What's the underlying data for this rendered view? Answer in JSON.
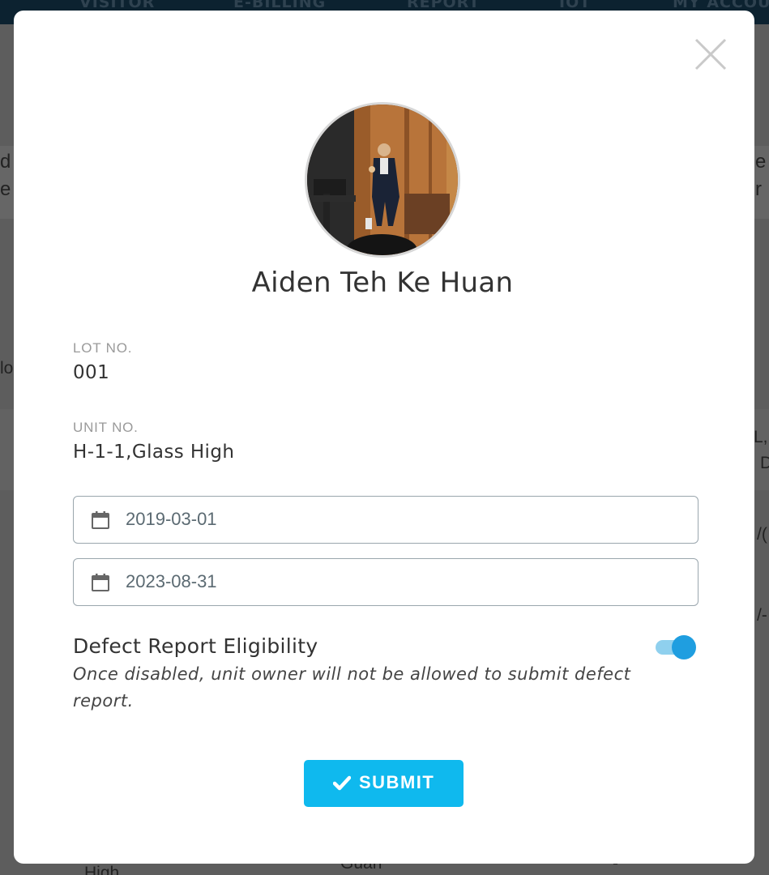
{
  "background": {
    "nav_items": [
      "VISITOR",
      "E-BILLING",
      "REPORT",
      "IOT",
      "MY ACCOU"
    ],
    "fragments": {
      "left_top": "d",
      "left_mid": "e",
      "left_input": "lo",
      "right_top": "e",
      "right_mid": "r",
      "right_p": "L,P",
      "right_d": "D",
      "right_slash1": "/(",
      "right_slash2": "/-",
      "bottom_left": "High",
      "bottom_mid": "Guan",
      "bottom_dash": "-"
    }
  },
  "modal": {
    "close_icon": "close-icon",
    "user": {
      "name": "Aiden Teh Ke Huan",
      "avatar_alt": "profile-photo"
    },
    "lot": {
      "label": "LOT NO.",
      "value": "001"
    },
    "unit": {
      "label": "UNIT NO.",
      "value": "H-1-1,Glass High"
    },
    "start_date": {
      "value": "2019-03-01",
      "icon": "calendar-icon"
    },
    "end_date": {
      "value": "2023-08-31",
      "icon": "calendar-icon"
    },
    "defect_toggle": {
      "title": "Defect Report Eligibility",
      "description": "Once disabled, unit owner will not be allowed to submit defect report.",
      "enabled": true
    },
    "submit": {
      "label": "SUBMIT",
      "icon": "check-icon"
    }
  },
  "colors": {
    "accent": "#0fb9ee",
    "toggle_on": "#1f9ee0",
    "toggle_track": "#8fd0ee",
    "overlay": "#5d5d5d"
  }
}
